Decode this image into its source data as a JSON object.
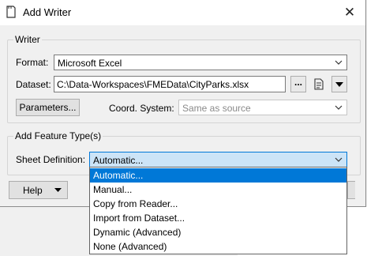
{
  "window": {
    "title": "Add Writer",
    "close_glyph": "✕"
  },
  "writer_group": {
    "title": "Writer",
    "format_label": "Format:",
    "format_value": "Microsoft Excel",
    "dataset_label": "Dataset:",
    "dataset_value": "C:\\Data-Workspaces\\FMEData\\CityParks.xlsx",
    "browse_label": "...",
    "parameters_label": "Parameters...",
    "coord_label": "Coord. System:",
    "coord_placeholder": "Same as source"
  },
  "feature_group": {
    "title": "Add Feature Type(s)",
    "sheet_label": "Sheet Definition:",
    "sheet_value": "Automatic..."
  },
  "footer": {
    "help_label": "Help"
  },
  "dropdown": {
    "options": [
      "Automatic...",
      "Manual...",
      "Copy from Reader...",
      "Import from Dataset...",
      "Dynamic (Advanced)",
      "None (Advanced)"
    ],
    "selected_index": 0
  },
  "colors": {
    "accent": "#0078d7",
    "focus_fill": "#cce4f7"
  },
  "icons": [
    "writer-icon",
    "close-icon",
    "chevron-down-icon",
    "file-icon",
    "dropdown-arrow-icon"
  ]
}
